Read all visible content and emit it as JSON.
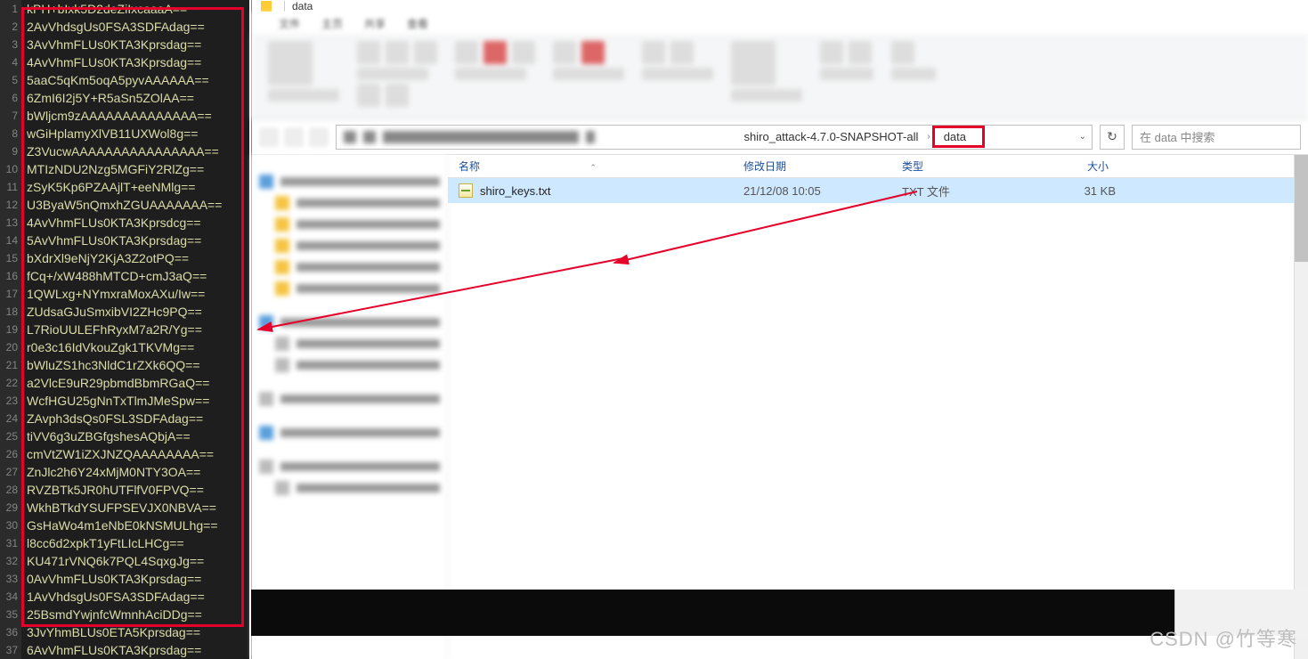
{
  "editor": {
    "lines": [
      "kPH+bIxk5D2deZiIxcaaaA==",
      "2AvVhdsgUs0FSA3SDFAdag==",
      "3AvVhmFLUs0KTA3Kprsdag==",
      "4AvVhmFLUs0KTA3Kprsdag==",
      "5aaC5qKm5oqA5pyvAAAAAA==",
      "6ZmI6I2j5Y+R5aSn5ZOlAA==",
      "bWljcm9zAAAAAAAAAAAAAA==",
      "wGiHplamyXlVB11UXWol8g==",
      "Z3VucwAAAAAAAAAAAAAAAA==",
      "MTIzNDU2Nzg5MGFiY2RlZg==",
      "zSyK5Kp6PZAAjlT+eeNMlg==",
      "U3ByaW5nQmxhZGUAAAAAAA==",
      "4AvVhmFLUs0KTA3Kprsdcg==",
      "5AvVhmFLUs0KTA3Kprsdag==",
      "bXdrXl9eNjY2KjA3Z2otPQ==",
      "fCq+/xW488hMTCD+cmJ3aQ==",
      "1QWLxg+NYmxraMoxAXu/Iw==",
      "ZUdsaGJuSmxibVI2ZHc9PQ==",
      "L7RioUULEFhRyxM7a2R/Yg==",
      "r0e3c16IdVkouZgk1TKVMg==",
      "bWluZS1hc3NldC1rZXk6QQ==",
      "a2VlcE9uR29pbmdBbmRGaQ==",
      "WcfHGU25gNnTxTlmJMeSpw==",
      "ZAvph3dsQs0FSL3SDFAdag==",
      "tiVV6g3uZBGfgshesAQbjA==",
      "cmVtZW1iZXJNZQAAAAAAAA==",
      "ZnJlc2h6Y24xMjM0NTY3OA==",
      "RVZBTk5JR0hUTFlfV0FPVQ==",
      "WkhBTkdYSUFPSEVJX0NBVA==",
      "GsHaWo4m1eNbE0kNSMULhg==",
      "l8cc6d2xpkT1yFtLIcLHCg==",
      "KU471rVNQ6k7PQL4SqxgJg==",
      "0AvVhmFLUs0KTA3Kprsdag==",
      "1AvVhdsgUs0FSA3SDFAdag==",
      "25BsmdYwjnfcWmnhAciDDg==",
      "3JvYhmBLUs0ETA5Kprsdag==",
      "6AvVhmFLUs0KTA3Kprsdag=="
    ]
  },
  "explorer": {
    "title": "data",
    "breadcrumb": {
      "segment1": "shiro_attack-4.7.0-SNAPSHOT-all",
      "segment2": "data"
    },
    "refresh_tooltip": "刷新",
    "search": {
      "placeholder": "在 data 中搜索"
    },
    "columns": {
      "name": "名称",
      "date": "修改日期",
      "type": "类型",
      "size": "大小"
    },
    "files": [
      {
        "name": "shiro_keys.txt",
        "date": "21/12/08 10:05",
        "type": "TXT 文件",
        "size": "31 KB"
      }
    ]
  },
  "watermark": "CSDN @竹等寒"
}
